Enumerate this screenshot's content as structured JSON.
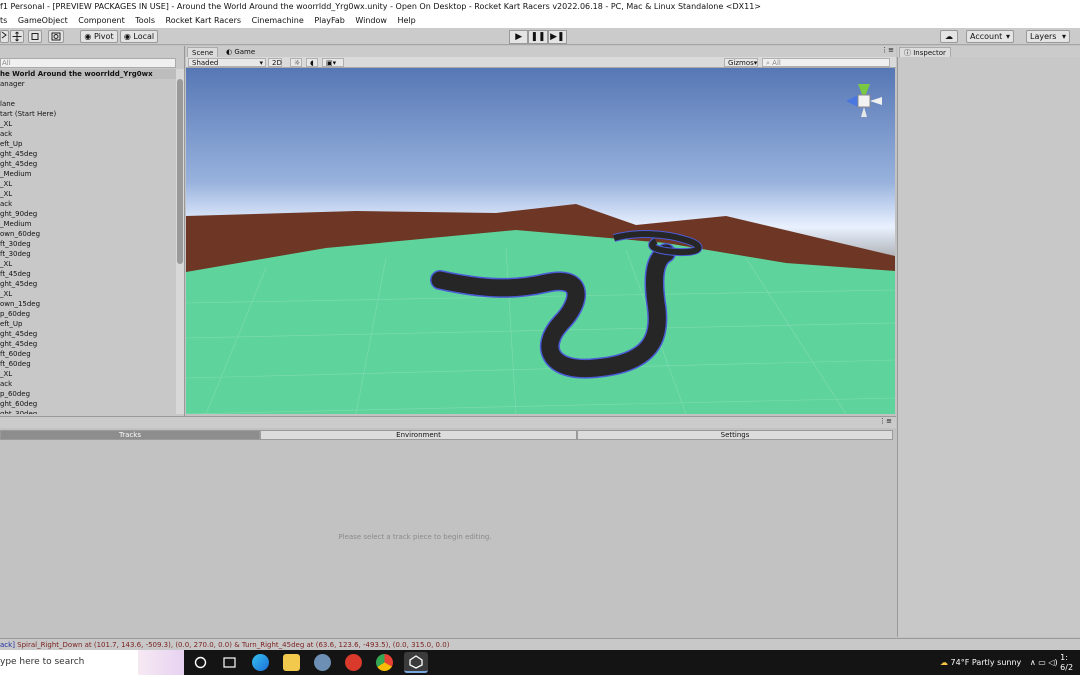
{
  "window": {
    "title": "f1 Personal - [PREVIEW PACKAGES IN USE] - Around the World Around the woorrldd_Yrg0wx.unity - Open On Desktop - Rocket Kart Racers v2022.06.18 - PC, Mac & Linux Standalone <DX11>"
  },
  "menu": [
    "ts",
    "GameObject",
    "Component",
    "Tools",
    "Rocket Kart Racers",
    "Cinemachine",
    "PlayFab",
    "Window",
    "Help"
  ],
  "toolbar": {
    "pivot": "Pivot",
    "local": "Local",
    "play": "▶",
    "pause": "❚❚",
    "step": "▶❚",
    "account": "Account",
    "layers": "Layers"
  },
  "hierarchy": {
    "search_placeholder": "All",
    "scene_name": "he World Around the woorrldd_Yrg0wx",
    "items": [
      "anager",
      "",
      "lane",
      "tart (Start Here)",
      "_XL",
      "ack",
      "eft_Up",
      "ght_45deg",
      "ght_45deg",
      "_Medium",
      "_XL",
      "_XL",
      "ack",
      "ght_90deg",
      "_Medium",
      "own_60deg",
      "ft_30deg",
      "ft_30deg",
      "_XL",
      "ft_45deg",
      "ght_45deg",
      "_XL",
      "own_15deg",
      "p_60deg",
      "eft_Up",
      "ght_45deg",
      "ght_45deg",
      "ft_60deg",
      "ft_60deg",
      "_XL",
      "ack",
      "p_60deg",
      "ght_60deg",
      "ght_30deg"
    ]
  },
  "scene_view": {
    "tab_scene": "Scene",
    "tab_game": "Game",
    "shading": "Shaded",
    "mode_2d": "2D",
    "gizmos": "Gizmos",
    "search_placeholder": "All"
  },
  "inspector": {
    "tab": "Inspector"
  },
  "track_panel": {
    "tabs": [
      "Tracks",
      "Environment",
      "Settings"
    ],
    "message": "Please select a track piece to begin editing."
  },
  "status": {
    "prefix": "ack]",
    "text": " Spiral_Right_Down at (101.7, 143.6, -509.3), (0.0, 270.0, 0.0) & Turn_Right_45deg at (63.6, 123.6, -493.5), (0.0, 315.0, 0.0)"
  },
  "taskbar": {
    "search_placeholder": "ype here to search",
    "weather": "74°F  Partly sunny",
    "clock_time": "1:",
    "clock_date": "6/2"
  },
  "colors": {
    "sky_top": "#5677b5",
    "horizon": "#e9f1ff",
    "ground": "#5fd39c",
    "terrain": "#6e3624",
    "track": "#262626",
    "track_outline": "#4b5cd6"
  }
}
